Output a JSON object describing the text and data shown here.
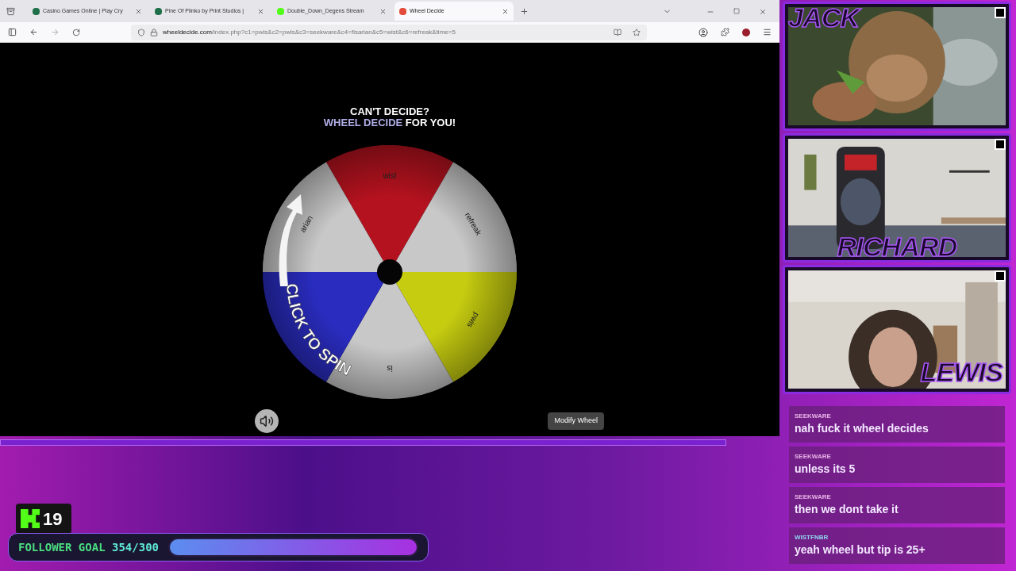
{
  "browser": {
    "tabs": [
      {
        "title": "Casino Games Online | Play Cry",
        "color": "#1f6f4a",
        "selected": false
      },
      {
        "title": "Pine Of Plinko by Print Studios |",
        "color": "#1f6f4a",
        "selected": false
      },
      {
        "title": "Double_Down_Degens Stream",
        "color": "#53fc18",
        "selected": false
      },
      {
        "title": "Wheel Decide",
        "color": "#e34b3c",
        "selected": true
      }
    ],
    "url_host": "wheeldecide.com",
    "url_path": "/index.php?c1=pwis&c2=pwis&c3=seekware&c4=fisarian&c5=wist&c6=refreak&time=5"
  },
  "page": {
    "heading": "CAN'T DECIDE?",
    "subheading": "WHEEL DECIDE",
    "subheading_rest": "FOR YOU!",
    "wheel": {
      "segments": [
        {
          "label": "wist",
          "color": "#b3121e"
        },
        {
          "label": "refreak",
          "color": "#c8c8c8"
        },
        {
          "label": "pwis",
          "color": "#c6cc10"
        },
        {
          "label": "is",
          "color": "#c8c8c8"
        },
        {
          "color": "#2a2cc0"
        },
        {
          "label": "arian",
          "color": "#c8c8c8"
        }
      ],
      "spin_label": "CLICK TO SPIN"
    },
    "modify_button": "Modify Wheel"
  },
  "overlay": {
    "followers": "19",
    "goal_label": "FOLLOWER GOAL",
    "goal_count": "354/300",
    "level": 1
  },
  "cams": [
    {
      "name": "JACK"
    },
    {
      "name": "RICHARD"
    },
    {
      "name": "LEWIS"
    }
  ],
  "chat": [
    {
      "user": "SEEKWARE",
      "color": "#e8b4e6",
      "text": "nah fuck it wheel decides"
    },
    {
      "user": "SEEKWARE",
      "color": "#e8b4e6",
      "text": "unless its 5"
    },
    {
      "user": "SEEKWARE",
      "color": "#e8b4e6",
      "text": "then we dont take it"
    },
    {
      "user": "WISTFNBR",
      "color": "#8fd8ee",
      "text": "yeah wheel but tip is 25+"
    }
  ]
}
